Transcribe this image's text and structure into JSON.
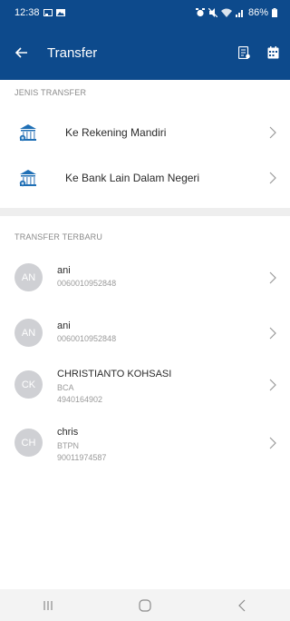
{
  "status_bar": {
    "time": "12:38",
    "battery": "86%"
  },
  "toolbar": {
    "title": "Transfer",
    "back_icon": "arrow-left-icon"
  },
  "jenis_transfer": {
    "header": "JENIS TRANSFER",
    "items": [
      {
        "label": "Ke Rekening Mandiri",
        "icon": "bank-icon"
      },
      {
        "label": "Ke Bank Lain Dalam Negeri",
        "icon": "bank-icon"
      }
    ]
  },
  "transfer_terbaru": {
    "header": "TRANSFER TERBARU",
    "items": [
      {
        "initials": "AN",
        "name": "ani",
        "bank": "",
        "account": "0060010952848"
      },
      {
        "initials": "AN",
        "name": "ani",
        "bank": "",
        "account": "0060010952848"
      },
      {
        "initials": "CK",
        "name": "CHRISTIANTO KOHSASI",
        "bank": "BCA",
        "account": "4940164902"
      },
      {
        "initials": "CH",
        "name": "chris",
        "bank": "BTPN",
        "account": "90011974587"
      }
    ]
  },
  "colors": {
    "primary": "#0d4a8c",
    "avatar": "#cfd0d4",
    "divider": "#eeeeee",
    "icon_accent": "#1f6fb5"
  }
}
